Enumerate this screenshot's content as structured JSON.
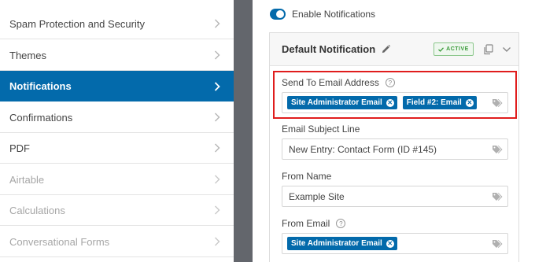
{
  "sidebar": {
    "items": [
      {
        "label": "Spam Protection and Security",
        "state": "normal"
      },
      {
        "label": "Themes",
        "state": "normal"
      },
      {
        "label": "Notifications",
        "state": "active"
      },
      {
        "label": "Confirmations",
        "state": "normal"
      },
      {
        "label": "PDF",
        "state": "normal"
      },
      {
        "label": "Airtable",
        "state": "disabled"
      },
      {
        "label": "Calculations",
        "state": "disabled"
      },
      {
        "label": "Conversational Forms",
        "state": "disabled"
      }
    ]
  },
  "toggle": {
    "label": "Enable Notifications",
    "on": true
  },
  "notification": {
    "title": "Default Notification",
    "badge": "ACTIVE",
    "fields": {
      "send_to": {
        "label": "Send To Email Address",
        "chips": [
          "Site Administrator Email",
          "Field #2: Email"
        ]
      },
      "subject": {
        "label": "Email Subject Line",
        "value": "New Entry: Contact Form (ID #145)"
      },
      "from_name": {
        "label": "From Name",
        "value": "Example Site"
      },
      "from_email": {
        "label": "From Email",
        "chips": [
          "Site Administrator Email"
        ]
      }
    }
  },
  "colors": {
    "accent": "#036aab",
    "highlight": "#e01d1d",
    "active_badge": "#3a9b3a"
  }
}
